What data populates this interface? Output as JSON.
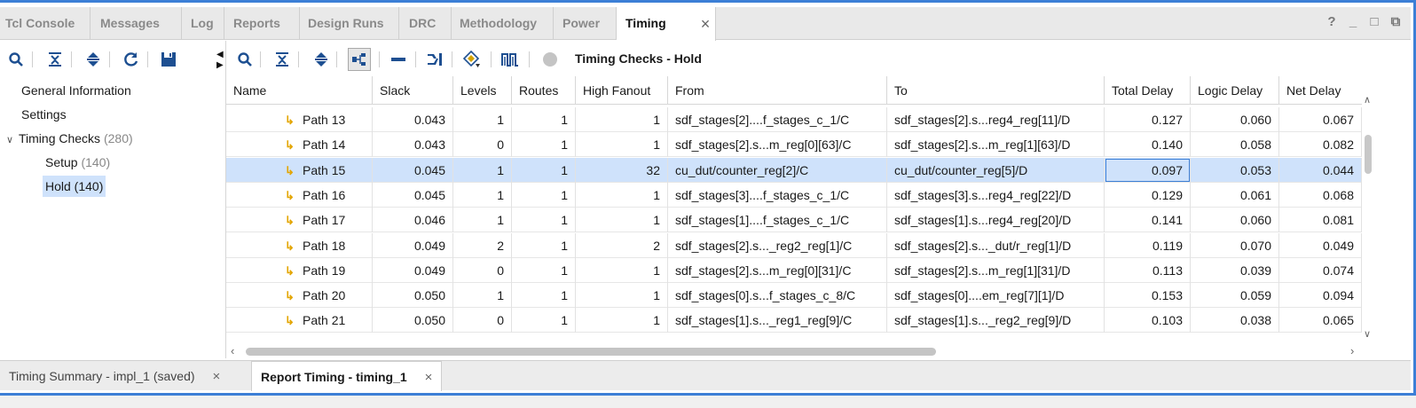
{
  "top_tabs": [
    "Tcl Console",
    "Messages",
    "Log",
    "Reports",
    "Design Runs",
    "DRC",
    "Methodology",
    "Power",
    "Timing"
  ],
  "active_tab": "Timing",
  "window_controls": [
    "?",
    "_",
    "□",
    "⧉"
  ],
  "tree": {
    "general": "General Information",
    "settings": "Settings",
    "timing_checks": "Timing Checks",
    "timing_checks_count": "(280)",
    "setup": "Setup",
    "setup_count": "(140)",
    "hold": "Hold (140)"
  },
  "panel_title": "Timing Checks - Hold",
  "columns": [
    "Name",
    "Slack",
    "Levels",
    "Routes",
    "High Fanout",
    "From",
    "To",
    "Total Delay",
    "Logic Delay",
    "Net Delay"
  ],
  "rows": [
    {
      "name": "Path 13",
      "slack": "0.043",
      "levels": "1",
      "routes": "1",
      "fanout": "1",
      "from": "sdf_stages[2]....f_stages_c_1/C",
      "to": "sdf_stages[2].s...reg4_reg[11]/D",
      "total": "0.127",
      "logic": "0.060",
      "net": "0.067"
    },
    {
      "name": "Path 14",
      "slack": "0.043",
      "levels": "0",
      "routes": "1",
      "fanout": "1",
      "from": "sdf_stages[2].s...m_reg[0][63]/C",
      "to": "sdf_stages[2].s...m_reg[1][63]/D",
      "total": "0.140",
      "logic": "0.058",
      "net": "0.082"
    },
    {
      "name": "Path 15",
      "slack": "0.045",
      "levels": "1",
      "routes": "1",
      "fanout": "32",
      "from": "cu_dut/counter_reg[2]/C",
      "to": "cu_dut/counter_reg[5]/D",
      "total": "0.097",
      "logic": "0.053",
      "net": "0.044"
    },
    {
      "name": "Path 16",
      "slack": "0.045",
      "levels": "1",
      "routes": "1",
      "fanout": "1",
      "from": "sdf_stages[3]....f_stages_c_1/C",
      "to": "sdf_stages[3].s...reg4_reg[22]/D",
      "total": "0.129",
      "logic": "0.061",
      "net": "0.068"
    },
    {
      "name": "Path 17",
      "slack": "0.046",
      "levels": "1",
      "routes": "1",
      "fanout": "1",
      "from": "sdf_stages[1]....f_stages_c_1/C",
      "to": "sdf_stages[1].s...reg4_reg[20]/D",
      "total": "0.141",
      "logic": "0.060",
      "net": "0.081"
    },
    {
      "name": "Path 18",
      "slack": "0.049",
      "levels": "2",
      "routes": "1",
      "fanout": "2",
      "from": "sdf_stages[2].s..._reg2_reg[1]/C",
      "to": "sdf_stages[2].s..._dut/r_reg[1]/D",
      "total": "0.119",
      "logic": "0.070",
      "net": "0.049"
    },
    {
      "name": "Path 19",
      "slack": "0.049",
      "levels": "0",
      "routes": "1",
      "fanout": "1",
      "from": "sdf_stages[2].s...m_reg[0][31]/C",
      "to": "sdf_stages[2].s...m_reg[1][31]/D",
      "total": "0.113",
      "logic": "0.039",
      "net": "0.074"
    },
    {
      "name": "Path 20",
      "slack": "0.050",
      "levels": "1",
      "routes": "1",
      "fanout": "1",
      "from": "sdf_stages[0].s...f_stages_c_8/C",
      "to": "sdf_stages[0]....em_reg[7][1]/D",
      "total": "0.153",
      "logic": "0.059",
      "net": "0.094"
    },
    {
      "name": "Path 21",
      "slack": "0.050",
      "levels": "0",
      "routes": "1",
      "fanout": "1",
      "from": "sdf_stages[1].s..._reg1_reg[9]/C",
      "to": "sdf_stages[1].s..._reg2_reg[9]/D",
      "total": "0.103",
      "logic": "0.038",
      "net": "0.065"
    }
  ],
  "bottom_tabs": [
    "Timing Summary - impl_1 (saved)",
    "Report Timing - timing_1"
  ],
  "accent_color": "#3c7fd6",
  "path_icon_color": "#e3a500"
}
